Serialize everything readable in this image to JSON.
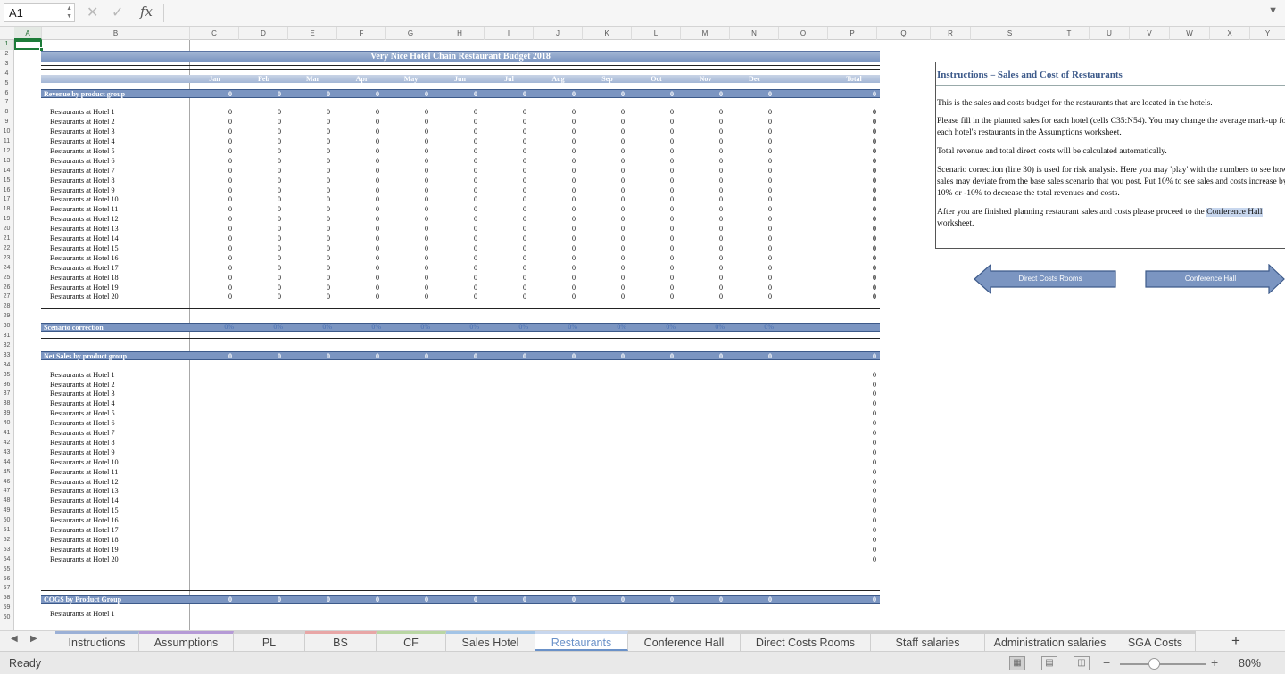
{
  "formula_bar": {
    "name_box": "A1",
    "cancel_icon": "close-icon",
    "confirm_icon": "check-icon",
    "fx_label": "fx",
    "formula": ""
  },
  "columns": [
    "A",
    "B",
    "C",
    "D",
    "E",
    "F",
    "G",
    "H",
    "I",
    "J",
    "K",
    "L",
    "M",
    "N",
    "O",
    "P",
    "Q",
    "R",
    "S",
    "T",
    "U",
    "V",
    "W",
    "X",
    "Y"
  ],
  "rows": [
    "1",
    "2",
    "3",
    "4",
    "5",
    "6",
    "7",
    "8",
    "9",
    "10",
    "11",
    "12",
    "13",
    "14",
    "15",
    "16",
    "17",
    "18",
    "19",
    "20",
    "21",
    "22",
    "23",
    "24",
    "25",
    "26",
    "27",
    "28",
    "29",
    "30",
    "31",
    "32",
    "33",
    "34",
    "35",
    "36",
    "37",
    "38",
    "39",
    "40",
    "41",
    "42",
    "43",
    "44",
    "45",
    "46",
    "47",
    "48",
    "49",
    "50",
    "51",
    "52",
    "53",
    "54",
    "55",
    "56",
    "57",
    "58",
    "59",
    "60"
  ],
  "sheet": {
    "title": "Very Nice Hotel Chain Restaurant Budget 2018",
    "months": [
      "Jan",
      "Feb",
      "Mar",
      "Apr",
      "May",
      "Jun",
      "Jul",
      "Aug",
      "Sep",
      "Oct",
      "Nov",
      "Dec"
    ],
    "total_label": "Total",
    "revenue_section": {
      "label": "Revenue by product group",
      "values": [
        "0",
        "0",
        "0",
        "0",
        "0",
        "0",
        "0",
        "0",
        "0",
        "0",
        "0",
        "0"
      ],
      "total": "0"
    },
    "hotels": [
      "Restaurants at Hotel 1",
      "Restaurants at Hotel 2",
      "Restaurants at Hotel 3",
      "Restaurants at Hotel 4",
      "Restaurants at Hotel 5",
      "Restaurants at Hotel 6",
      "Restaurants at Hotel 7",
      "Restaurants at Hotel 8",
      "Restaurants at Hotel 9",
      "Restaurants at Hotel 10",
      "Restaurants at Hotel 11",
      "Restaurants at Hotel 12",
      "Restaurants at Hotel 13",
      "Restaurants at Hotel 14",
      "Restaurants at Hotel 15",
      "Restaurants at Hotel 16",
      "Restaurants at Hotel 17",
      "Restaurants at Hotel 18",
      "Restaurants at Hotel 19",
      "Restaurants at Hotel 20"
    ],
    "zero": "0",
    "scenario_section": {
      "label": "Scenario correction",
      "values": [
        "0%",
        "0%",
        "0%",
        "0%",
        "0%",
        "0%",
        "0%",
        "0%",
        "0%",
        "0%",
        "0%",
        "0%"
      ]
    },
    "net_sales_section": {
      "label": "Net Sales by product group",
      "values": [
        "0",
        "0",
        "0",
        "0",
        "0",
        "0",
        "0",
        "0",
        "0",
        "0",
        "0",
        "0"
      ],
      "total": "0"
    },
    "cogs_section": {
      "label": "COGS by Product Group",
      "values": [
        "0",
        "0",
        "0",
        "0",
        "0",
        "0",
        "0",
        "0",
        "0",
        "0",
        "0",
        "0"
      ],
      "total": "0"
    },
    "cogs_first_row": "Restaurants at Hotel 1"
  },
  "instructions": {
    "title": "Instructions – Sales and Cost of Restaurants",
    "p1": "This is the sales and costs budget for the restaurants that are located in the hotels.",
    "p2": "Please fill in the planned sales for each hotel (cells C35:N54). You may change the average mark-up for each hotel's restaurants in the Assumptions worksheet.",
    "p3": "Total revenue and total direct costs will be calculated automatically.",
    "p4": "Scenario correction (line 30) is used for risk analysis. Here you may 'play' with the numbers to see how sales may deviate from the base sales scenario that you post. Put 10% to see sales and costs increase by 10% or -10% to decrease the total revenues and costs.",
    "p5_pre": "After you are finished planning restaurant sales and costs please proceed to the ",
    "p5_link": "Conference Hall",
    "p5_post": " worksheet."
  },
  "nav_buttons": {
    "prev": "Direct Costs Rooms",
    "next": "Conference Hall"
  },
  "tabs": [
    "Instructions",
    "Assumptions",
    "PL",
    "BS",
    "CF",
    "Sales Hotel",
    "Restaurants",
    "Conference Hall",
    "Direct Costs Rooms",
    "Staff salaries",
    "Administration salaries",
    "SGA Costs"
  ],
  "active_tab": "Restaurants",
  "tab_colors": [
    "#9bb0d6",
    "#b59ad6",
    "#d4d4d4",
    "#e8a6a6",
    "#b9d6a3",
    "#a3c4e6",
    "#6a91c8",
    "#cfcfcf",
    "#cfcfcf",
    "#cfcfcf",
    "#cfcfcf",
    "#cfcfcf"
  ],
  "status": {
    "text": "Ready",
    "zoom": "80%"
  }
}
